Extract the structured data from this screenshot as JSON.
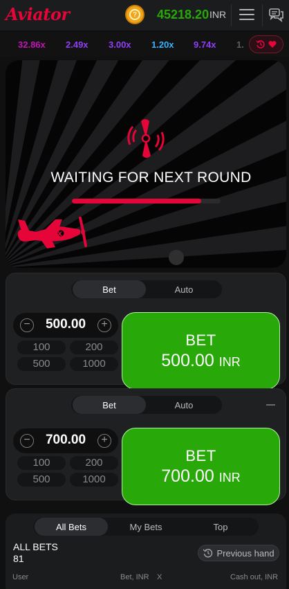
{
  "header": {
    "logo": "Aviator",
    "balance": "45218.20",
    "currency": "INR",
    "coin_symbol": "?",
    "menu_icon": "hamburger-menu-icon",
    "chat_icon": "chat-bubbles-icon"
  },
  "multipliers": [
    {
      "value": "32.86x",
      "color": "#c017b4"
    },
    {
      "value": "2.49x",
      "color": "#913ef8"
    },
    {
      "value": "3.00x",
      "color": "#913ef8"
    },
    {
      "value": "1.20x",
      "color": "#34b4ff"
    },
    {
      "value": "9.74x",
      "color": "#913ef8"
    },
    {
      "value": "1.",
      "color": "#5e5e5e"
    }
  ],
  "history_button": {
    "icons": [
      "history-icon",
      "heart-icon"
    ]
  },
  "stage": {
    "status": "WAITING FOR NEXT ROUND",
    "progress": 0.87
  },
  "bet_panels": [
    {
      "tabs": [
        "Bet",
        "Auto"
      ],
      "amount": "500.00",
      "quick": [
        "100",
        "200",
        "500",
        "1000"
      ],
      "button_label": "BET",
      "button_amount": "500.00",
      "button_currency": "INR"
    },
    {
      "tabs": [
        "Bet",
        "Auto"
      ],
      "amount": "700.00",
      "quick": [
        "100",
        "200",
        "500",
        "1000"
      ],
      "button_label": "BET",
      "button_amount": "700.00",
      "button_currency": "INR"
    }
  ],
  "bets": {
    "tabs": [
      "All Bets",
      "My Bets",
      "Top"
    ],
    "title": "ALL BETS",
    "count": "81",
    "previous_hand": "Previous hand",
    "columns": [
      "User",
      "Bet, INR",
      "X",
      "Cash out, INR"
    ]
  },
  "colors": {
    "brand_red": "#e50539",
    "green": "#28a909",
    "purple": "#913ef8",
    "blue": "#34b4ff",
    "pink": "#c017b4"
  }
}
